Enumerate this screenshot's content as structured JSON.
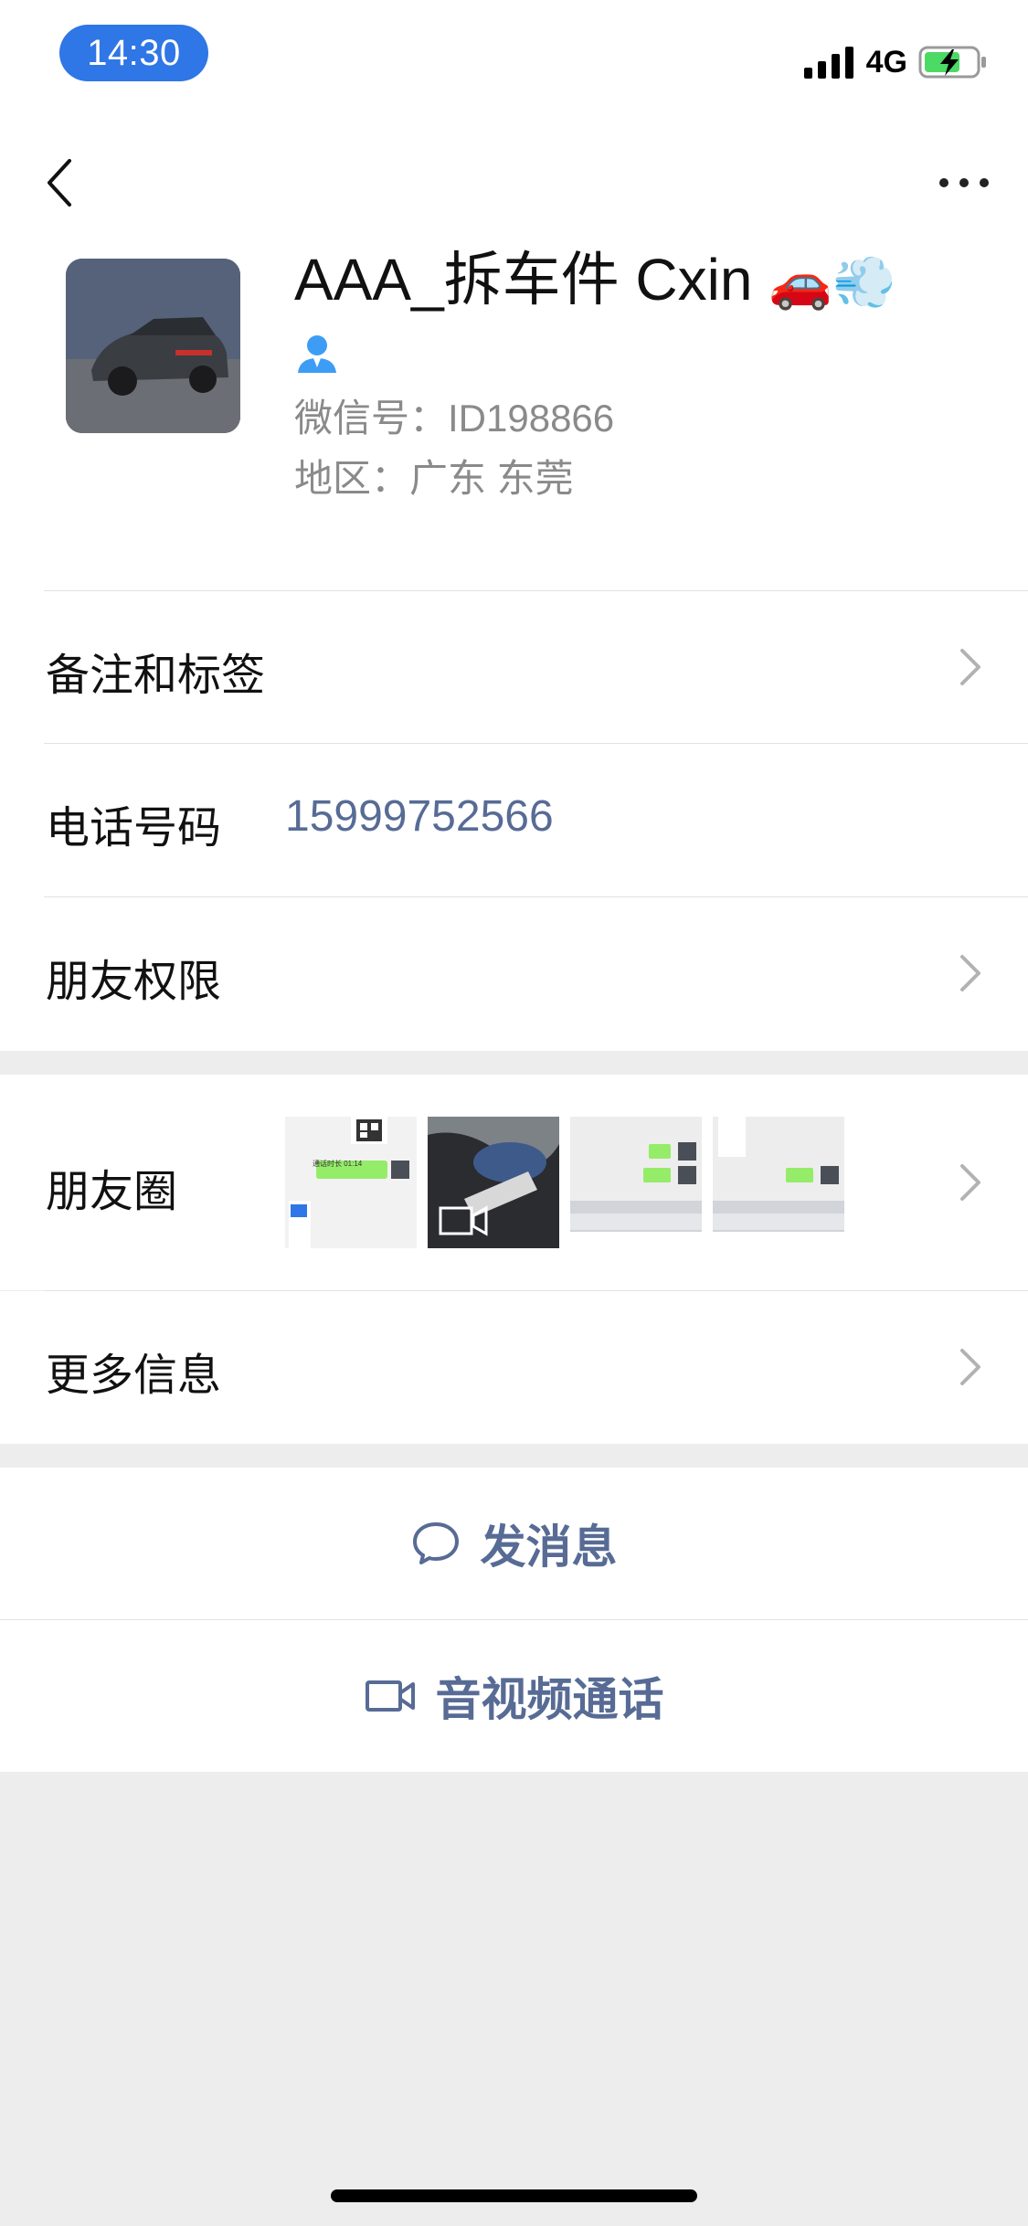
{
  "status_bar": {
    "time": "14:30",
    "network": "4G",
    "icons": [
      "signal-icon",
      "battery-charging-icon"
    ]
  },
  "nav": {
    "back_icon": "chevron-left-icon",
    "more_icon": "more-dots-icon"
  },
  "profile": {
    "nickname": "AAA_拆车件 Cxin",
    "nickname_emoji": "🚗💨",
    "friend_icon": "person-icon",
    "wechat_id": "微信号：ID198866",
    "region": "地区：广东 东莞"
  },
  "rows": {
    "remarks_tags": "备注和标签",
    "phone_label": "电话号码",
    "phone_value": "15999752566",
    "friend_permissions": "朋友权限",
    "moments": "朋友圈",
    "more_info": "更多信息"
  },
  "moments_thumbnails": {
    "thumb1_text": "通话时长 01:14"
  },
  "actions": {
    "send_message": "发消息",
    "send_message_icon": "chat-bubble-icon",
    "av_call": "音视频通话",
    "av_call_icon": "video-camera-icon"
  },
  "colors": {
    "status_time_bg": "#2f76e6",
    "link": "#576b95",
    "page_bg": "#ededed",
    "friend_icon": "#3d9df5"
  }
}
